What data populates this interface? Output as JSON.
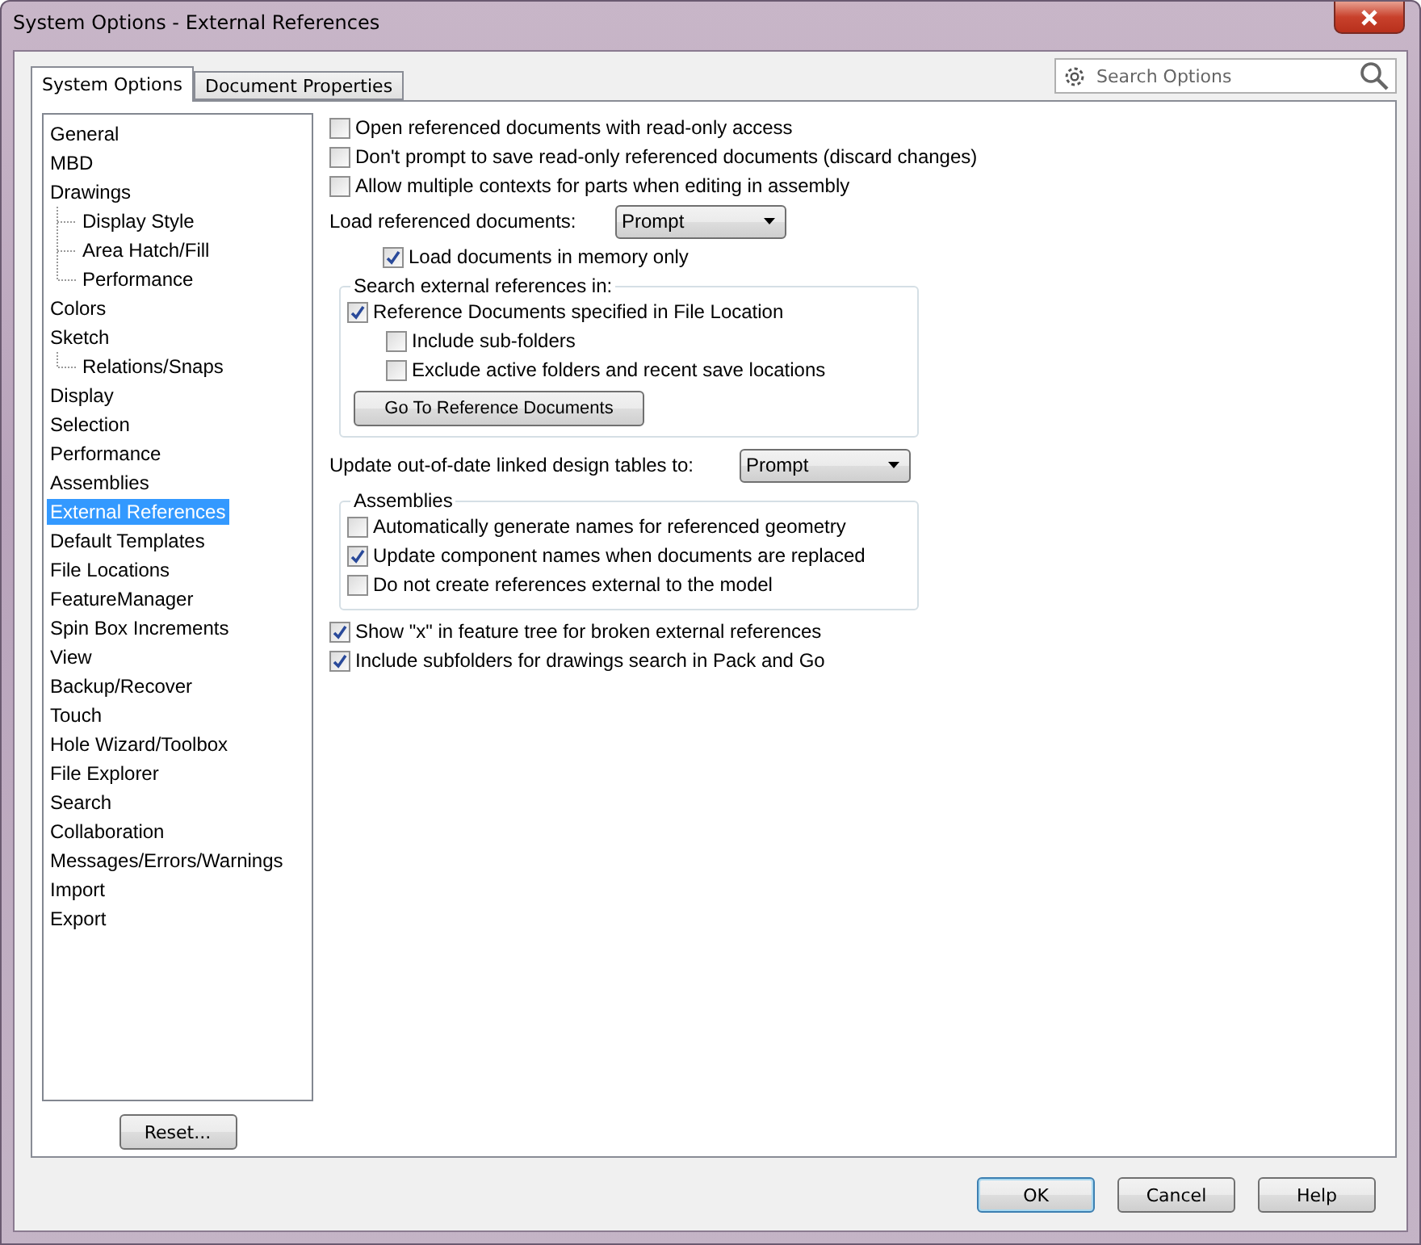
{
  "window": {
    "title": "System Options - External References"
  },
  "tabs": [
    {
      "label": "System Options",
      "selected": true
    },
    {
      "label": "Document Properties",
      "selected": false
    }
  ],
  "search": {
    "placeholder": "Search Options"
  },
  "tree": [
    {
      "label": "General",
      "selected": false
    },
    {
      "label": "MBD",
      "selected": false
    },
    {
      "label": "Drawings",
      "selected": false,
      "children": [
        {
          "label": "Display Style",
          "selected": false
        },
        {
          "label": "Area Hatch/Fill",
          "selected": false
        },
        {
          "label": "Performance",
          "selected": false
        }
      ]
    },
    {
      "label": "Colors",
      "selected": false
    },
    {
      "label": "Sketch",
      "selected": false,
      "children": [
        {
          "label": "Relations/Snaps",
          "selected": false
        }
      ]
    },
    {
      "label": "Display",
      "selected": false
    },
    {
      "label": "Selection",
      "selected": false
    },
    {
      "label": "Performance",
      "selected": false
    },
    {
      "label": "Assemblies",
      "selected": false
    },
    {
      "label": "External References",
      "selected": true
    },
    {
      "label": "Default Templates",
      "selected": false
    },
    {
      "label": "File Locations",
      "selected": false
    },
    {
      "label": "FeatureManager",
      "selected": false
    },
    {
      "label": "Spin Box Increments",
      "selected": false
    },
    {
      "label": "View",
      "selected": false
    },
    {
      "label": "Backup/Recover",
      "selected": false
    },
    {
      "label": "Touch",
      "selected": false
    },
    {
      "label": "Hole Wizard/Toolbox",
      "selected": false
    },
    {
      "label": "File Explorer",
      "selected": false
    },
    {
      "label": "Search",
      "selected": false
    },
    {
      "label": "Collaboration",
      "selected": false
    },
    {
      "label": "Messages/Errors/Warnings",
      "selected": false
    },
    {
      "label": "Import",
      "selected": false
    },
    {
      "label": "Export",
      "selected": false
    }
  ],
  "reset_button": "Reset...",
  "settings": [
    {
      "kind": "checkbox",
      "label": "Open referenced documents with read-only access",
      "checked": false
    },
    {
      "kind": "checkbox",
      "label": "Don't prompt to save read-only referenced documents (discard changes)",
      "checked": false
    },
    {
      "kind": "checkbox",
      "label": "Allow multiple contexts for parts when editing in assembly",
      "checked": false
    },
    {
      "kind": "select",
      "label": "Load referenced documents:",
      "value": "Prompt",
      "children": [
        {
          "kind": "checkbox",
          "label": "Load documents in memory only",
          "checked": true
        }
      ]
    },
    {
      "kind": "group",
      "title": "Search external references in:",
      "items": [
        {
          "kind": "checkbox",
          "label": "Reference Documents specified in File Location",
          "checked": true,
          "children": [
            {
              "kind": "checkbox",
              "label": "Include sub-folders",
              "checked": false
            },
            {
              "kind": "checkbox",
              "label": "Exclude active folders and recent save locations",
              "checked": false
            }
          ]
        },
        {
          "kind": "button",
          "label": "Go To Reference Documents"
        }
      ]
    },
    {
      "kind": "select",
      "label": "Update out-of-date linked design tables to:",
      "value": "Prompt"
    },
    {
      "kind": "group",
      "title": "Assemblies",
      "items": [
        {
          "kind": "checkbox",
          "label": "Automatically generate names for referenced geometry",
          "checked": false
        },
        {
          "kind": "checkbox",
          "label": "Update component names when documents are replaced",
          "checked": true
        },
        {
          "kind": "checkbox",
          "label": "Do not create references external to the model",
          "checked": false
        }
      ]
    },
    {
      "kind": "checkbox",
      "label": "Show \"x\" in feature tree for broken external references",
      "checked": true
    },
    {
      "kind": "checkbox",
      "label": "Include subfolders for drawings search in Pack and Go",
      "checked": true
    }
  ],
  "buttons": [
    {
      "label": "OK",
      "default": true
    },
    {
      "label": "Cancel",
      "default": false
    },
    {
      "label": "Help",
      "default": false
    }
  ]
}
